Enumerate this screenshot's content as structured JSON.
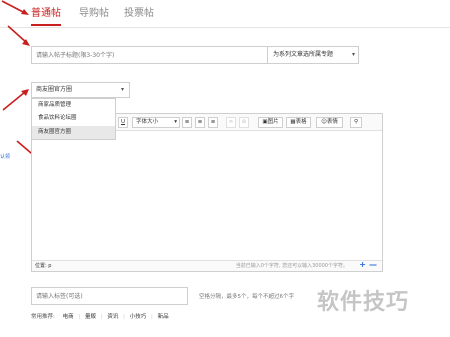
{
  "tabs": [
    {
      "label": "普通帖",
      "active": true
    },
    {
      "label": "导购帖",
      "active": false
    },
    {
      "label": "投票帖",
      "active": false
    }
  ],
  "title_input": {
    "placeholder": "请输入帖子标题(限3-30个字)"
  },
  "topic_select": {
    "value": "为系列文章选所属专题"
  },
  "category_select": {
    "value": "商友圈官方圈",
    "options": [
      "商家品质管理",
      "食品饮料论坛圈",
      "商友圈官方圈"
    ],
    "selected_index": 2
  },
  "toolbar": {
    "underline": "U",
    "font_size": "字体大小",
    "image": "图片",
    "table": "表格",
    "emoji": "表情"
  },
  "status_bar": {
    "path": "位置: p",
    "counter": "当前已输入0个字符, 您还可以输入30000个字符。",
    "zoom_in": "+",
    "zoom_out": "—"
  },
  "side_label": "认领",
  "tag_input": {
    "placeholder": "请输入标签(可选)"
  },
  "tag_hint": "空格分隔，最多5个，每个不超过6个字",
  "recommend": {
    "label": "常用推荐:",
    "tags": [
      "电商",
      "量贩",
      "资讯",
      "小技巧",
      "新品"
    ]
  },
  "watermark": "软件技巧",
  "colors": {
    "accent": "#c8201e",
    "link": "#2b6cd6"
  }
}
